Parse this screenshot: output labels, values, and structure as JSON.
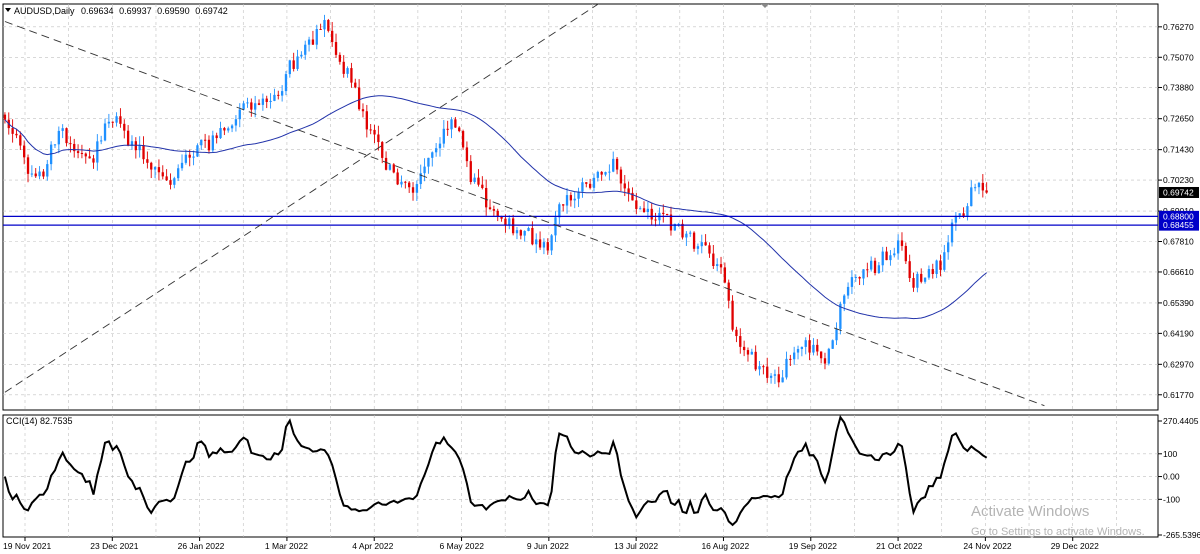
{
  "chart_data": {
    "type": "candlestick",
    "symbol": "AUDUSD",
    "timeframe": "Daily",
    "header_label": "AUDUSD,Daily",
    "ohlc_readout": {
      "open": "0.69634",
      "high": "0.69937",
      "low": "0.69590",
      "close": "0.69742"
    },
    "price_axis": {
      "min": 0.6117,
      "max": 0.7717,
      "ticks": [
        "0.76270",
        "0.75070",
        "0.73880",
        "0.72650",
        "0.71430",
        "0.70230",
        "0.69010",
        "0.67810",
        "0.66610",
        "0.65390",
        "0.64190",
        "0.62970",
        "0.61770"
      ]
    },
    "time_axis": {
      "labels": [
        "19 Nov 2021",
        "23 Dec 2021",
        "26 Jan 2022",
        "1 Mar 2022",
        "4 Apr 2022",
        "6 May 2022",
        "9 Jun 2022",
        "13 Jul 2022",
        "16 Aug 2022",
        "19 Sep 2022",
        "21 Oct 2022",
        "24 Nov 2022",
        "29 Dec 2022"
      ]
    },
    "current_price": "0.69742",
    "horizontal_levels": [
      {
        "value": 0.688,
        "label": "0.68800"
      },
      {
        "value": 0.68455,
        "label": "0.68455"
      }
    ],
    "trendlines": [
      {
        "style": "dashed",
        "from": {
          "bar": 0,
          "price": 0.7648
        },
        "to": {
          "bar": 270,
          "price": 0.6134
        }
      },
      {
        "style": "dashed",
        "from": {
          "bar": 0,
          "price": 0.6187
        },
        "to": {
          "bar": 165,
          "price": 0.7825
        }
      }
    ],
    "bars": {
      "count": 300,
      "last_bar_index": 255,
      "trend_anchors": [
        [
          0,
          0.724
        ],
        [
          8,
          0.703
        ],
        [
          15,
          0.72
        ],
        [
          22,
          0.711
        ],
        [
          28,
          0.726
        ],
        [
          35,
          0.714
        ],
        [
          42,
          0.701
        ],
        [
          50,
          0.715
        ],
        [
          58,
          0.721
        ],
        [
          63,
          0.732
        ],
        [
          70,
          0.735
        ],
        [
          75,
          0.748
        ],
        [
          80,
          0.756
        ],
        [
          82,
          0.764
        ],
        [
          88,
          0.745
        ],
        [
          95,
          0.724
        ],
        [
          100,
          0.706
        ],
        [
          105,
          0.698
        ],
        [
          110,
          0.71
        ],
        [
          117,
          0.726
        ],
        [
          122,
          0.701
        ],
        [
          127,
          0.69
        ],
        [
          134,
          0.682
        ],
        [
          140,
          0.676
        ],
        [
          146,
          0.696
        ],
        [
          152,
          0.702
        ],
        [
          158,
          0.709
        ],
        [
          163,
          0.694
        ],
        [
          170,
          0.688
        ],
        [
          176,
          0.682
        ],
        [
          180,
          0.677
        ],
        [
          186,
          0.666
        ],
        [
          190,
          0.638
        ],
        [
          196,
          0.63
        ],
        [
          200,
          0.624
        ],
        [
          207,
          0.638
        ],
        [
          213,
          0.631
        ],
        [
          219,
          0.662
        ],
        [
          225,
          0.668
        ],
        [
          232,
          0.676
        ],
        [
          236,
          0.662
        ],
        [
          242,
          0.668
        ],
        [
          248,
          0.689
        ],
        [
          252,
          0.699
        ],
        [
          255,
          0.6974
        ]
      ],
      "style": {
        "up_color": "#1e90ff",
        "down_color": "#e00000"
      }
    },
    "moving_average": {
      "color": "#2233aa",
      "period_label": ""
    },
    "indicator": {
      "name": "CCI(14)",
      "label": "CCI(14) 82.7535",
      "current": 82.7535,
      "ticks": [
        "270.4405",
        "100",
        "0.00",
        "-100",
        "-265.5396"
      ],
      "range": [
        -265.5396,
        270.4405
      ],
      "line_color": "#000000"
    },
    "colors": {
      "grid": "#c0c0c0",
      "axis": "#000000",
      "level_line": "#0000c8",
      "level_label_bg": "#0000c8",
      "current_price_bg": "#000000"
    },
    "grid": true
  },
  "watermark": {
    "title": "Activate Windows",
    "subtitle": "Go to Settings to activate Windows."
  }
}
